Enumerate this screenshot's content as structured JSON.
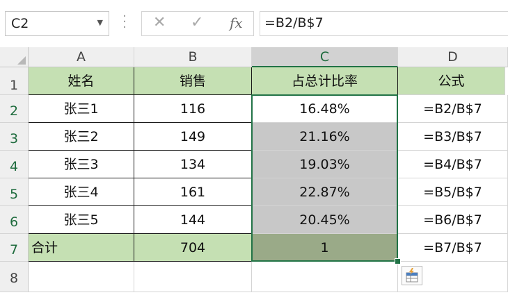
{
  "name_box": {
    "value": "C2"
  },
  "formula_bar": {
    "value": "=B2/B$7"
  },
  "columns": [
    "A",
    "B",
    "C",
    "D"
  ],
  "rows": [
    "1",
    "2",
    "3",
    "4",
    "5",
    "6",
    "7",
    "8"
  ],
  "header_row": [
    "姓名",
    "销售",
    "占总计比率",
    "公式"
  ],
  "data_rows": [
    {
      "name": "张三1",
      "sales": "116",
      "ratio": "16.48%",
      "formula": "=B2/B$7"
    },
    {
      "name": "张三2",
      "sales": "149",
      "ratio": "21.16%",
      "formula": "=B3/B$7"
    },
    {
      "name": "张三3",
      "sales": "134",
      "ratio": "19.03%",
      "formula": "=B4/B$7"
    },
    {
      "name": "张三4",
      "sales": "161",
      "ratio": "22.87%",
      "formula": "=B5/B$7"
    },
    {
      "name": "张三5",
      "sales": "144",
      "ratio": "20.45%",
      "formula": "=B6/B$7"
    }
  ],
  "total_row": {
    "name": "合计",
    "sales": "704",
    "ratio": "1",
    "formula": "=B7/B$7"
  },
  "colors": {
    "accent": "#217346",
    "header_fill": "#c5e0b3",
    "selection_fill": "#c8c8c8",
    "total_fill": "#9aaa88"
  }
}
